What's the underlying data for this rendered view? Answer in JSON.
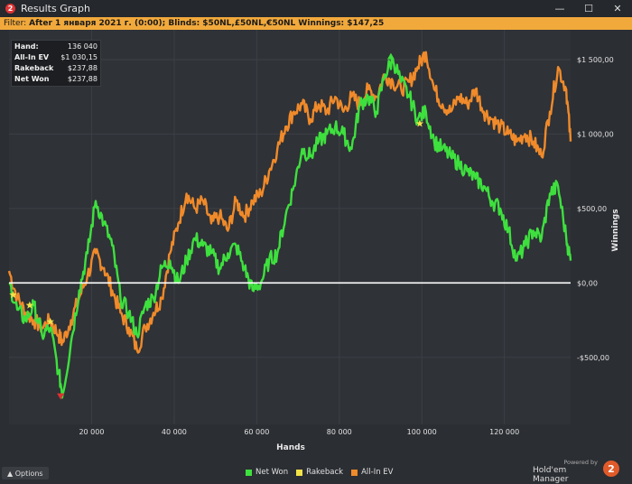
{
  "window": {
    "title": "Results Graph",
    "minimize": "—",
    "maximize": "☐",
    "close": "✕"
  },
  "filter": {
    "label": "Filter:",
    "value": "After 1 января 2021 г. (0:00); Blinds: $50NL,£50NL,€50NL Winnings: $147,25"
  },
  "stats": [
    {
      "label": "Hand:",
      "value": "136 040"
    },
    {
      "label": "All-In EV",
      "value": "$1 030,15"
    },
    {
      "label": "Rakeback",
      "value": "$237,88"
    },
    {
      "label": "Net Won",
      "value": "$237,88"
    }
  ],
  "options_label": "Options",
  "brand": {
    "powered": "Powered by",
    "name": "Hold'em Manager",
    "logo": "2"
  },
  "colors": {
    "net_won": "#3ee03e",
    "rakeback": "#f2e24a",
    "all_in_ev": "#f08a2a",
    "zero_line": "#ffffff",
    "grid": "#3c4046"
  },
  "chart_data": {
    "type": "line",
    "xlabel": "Hands",
    "ylabel": "Winnings",
    "xlim": [
      0,
      136040
    ],
    "ylim": [
      -950,
      1700
    ],
    "x_ticks": [
      20000,
      40000,
      60000,
      80000,
      100000,
      120000
    ],
    "x_tick_labels": [
      "20 000",
      "40 000",
      "60 000",
      "80 000",
      "100 000",
      "120 000"
    ],
    "y_ticks": [
      -500,
      0,
      500,
      1000,
      1500
    ],
    "y_tick_labels": [
      "-$500,00",
      "$0,00",
      "$500,00",
      "$1 000,00",
      "$1 500,00"
    ],
    "grid": true,
    "legend_position": "bottom",
    "series": [
      {
        "name": "Net Won",
        "color": "#3ee03e",
        "x": [
          0,
          2000,
          4000,
          6000,
          8000,
          10000,
          12000,
          13000,
          15000,
          17000,
          19000,
          21000,
          23000,
          25000,
          27000,
          29000,
          31000,
          33000,
          35000,
          37000,
          39000,
          41000,
          43000,
          45000,
          47000,
          49000,
          51000,
          53000,
          55000,
          57000,
          59000,
          61000,
          63000,
          65000,
          67000,
          69000,
          71000,
          73000,
          75000,
          77000,
          79000,
          81000,
          83000,
          85000,
          87000,
          89000,
          91000,
          93000,
          95000,
          97000,
          99000,
          101000,
          103000,
          105000,
          107000,
          109000,
          111000,
          113000,
          115000,
          117000,
          119000,
          121000,
          123000,
          125000,
          127000,
          129000,
          131000,
          133000,
          135000,
          136040
        ],
        "y": [
          0,
          -180,
          -250,
          -150,
          -350,
          -300,
          -600,
          -750,
          -400,
          -50,
          200,
          550,
          400,
          250,
          -100,
          -200,
          -350,
          -150,
          -100,
          100,
          150,
          0,
          150,
          300,
          250,
          200,
          100,
          200,
          250,
          100,
          -50,
          0,
          150,
          200,
          450,
          650,
          900,
          850,
          950,
          1000,
          1050,
          1000,
          900,
          1200,
          1250,
          1150,
          1400,
          1500,
          1350,
          1250,
          1100,
          1150,
          950,
          900,
          850,
          800,
          750,
          700,
          650,
          550,
          500,
          350,
          150,
          250,
          350,
          300,
          600,
          650,
          300,
          150
        ]
      },
      {
        "name": "Rakeback",
        "color": "#f2e24a",
        "x": [
          0,
          136040
        ],
        "y": [
          0,
          0
        ]
      },
      {
        "name": "All-In EV",
        "color": "#f08a2a",
        "x": [
          0,
          2000,
          4000,
          6000,
          8000,
          10000,
          12000,
          13000,
          15000,
          17000,
          19000,
          21000,
          23000,
          25000,
          27000,
          29000,
          31000,
          33000,
          35000,
          37000,
          39000,
          41000,
          43000,
          45000,
          47000,
          49000,
          51000,
          53000,
          55000,
          57000,
          59000,
          61000,
          63000,
          65000,
          67000,
          69000,
          71000,
          73000,
          75000,
          77000,
          79000,
          81000,
          83000,
          85000,
          87000,
          89000,
          91000,
          93000,
          95000,
          97000,
          99000,
          101000,
          103000,
          105000,
          107000,
          109000,
          111000,
          113000,
          115000,
          117000,
          119000,
          121000,
          123000,
          125000,
          127000,
          129000,
          131000,
          133000,
          135000,
          136040
        ],
        "y": [
          80,
          -100,
          -200,
          -250,
          -300,
          -250,
          -350,
          -400,
          -250,
          -100,
          50,
          200,
          100,
          -50,
          -200,
          -300,
          -450,
          -300,
          -200,
          -100,
          200,
          400,
          600,
          500,
          550,
          400,
          450,
          350,
          550,
          450,
          550,
          600,
          750,
          900,
          1050,
          1150,
          1200,
          1100,
          1200,
          1150,
          1250,
          1150,
          1250,
          1200,
          1300,
          1250,
          1400,
          1350,
          1300,
          1350,
          1450,
          1550,
          1300,
          1200,
          1150,
          1250,
          1200,
          1300,
          1150,
          1100,
          1050,
          1000,
          950,
          1000,
          950,
          850,
          1150,
          1450,
          1300,
          950
        ]
      }
    ],
    "markers": [
      {
        "shape": "star",
        "color": "#f2e24a",
        "x": 1000,
        "y": -80
      },
      {
        "shape": "star",
        "color": "#f2e24a",
        "x": 5000,
        "y": -150
      },
      {
        "shape": "star",
        "color": "#f2e24a",
        "x": 10000,
        "y": -260
      },
      {
        "shape": "star",
        "color": "#f2e24a",
        "x": 99500,
        "y": 1070
      },
      {
        "shape": "triangle-down",
        "color": "#e03030",
        "x": 12500,
        "y": -760
      },
      {
        "shape": "triangle-up",
        "color": "#3ee03e",
        "x": 92500,
        "y": 1520
      }
    ]
  }
}
